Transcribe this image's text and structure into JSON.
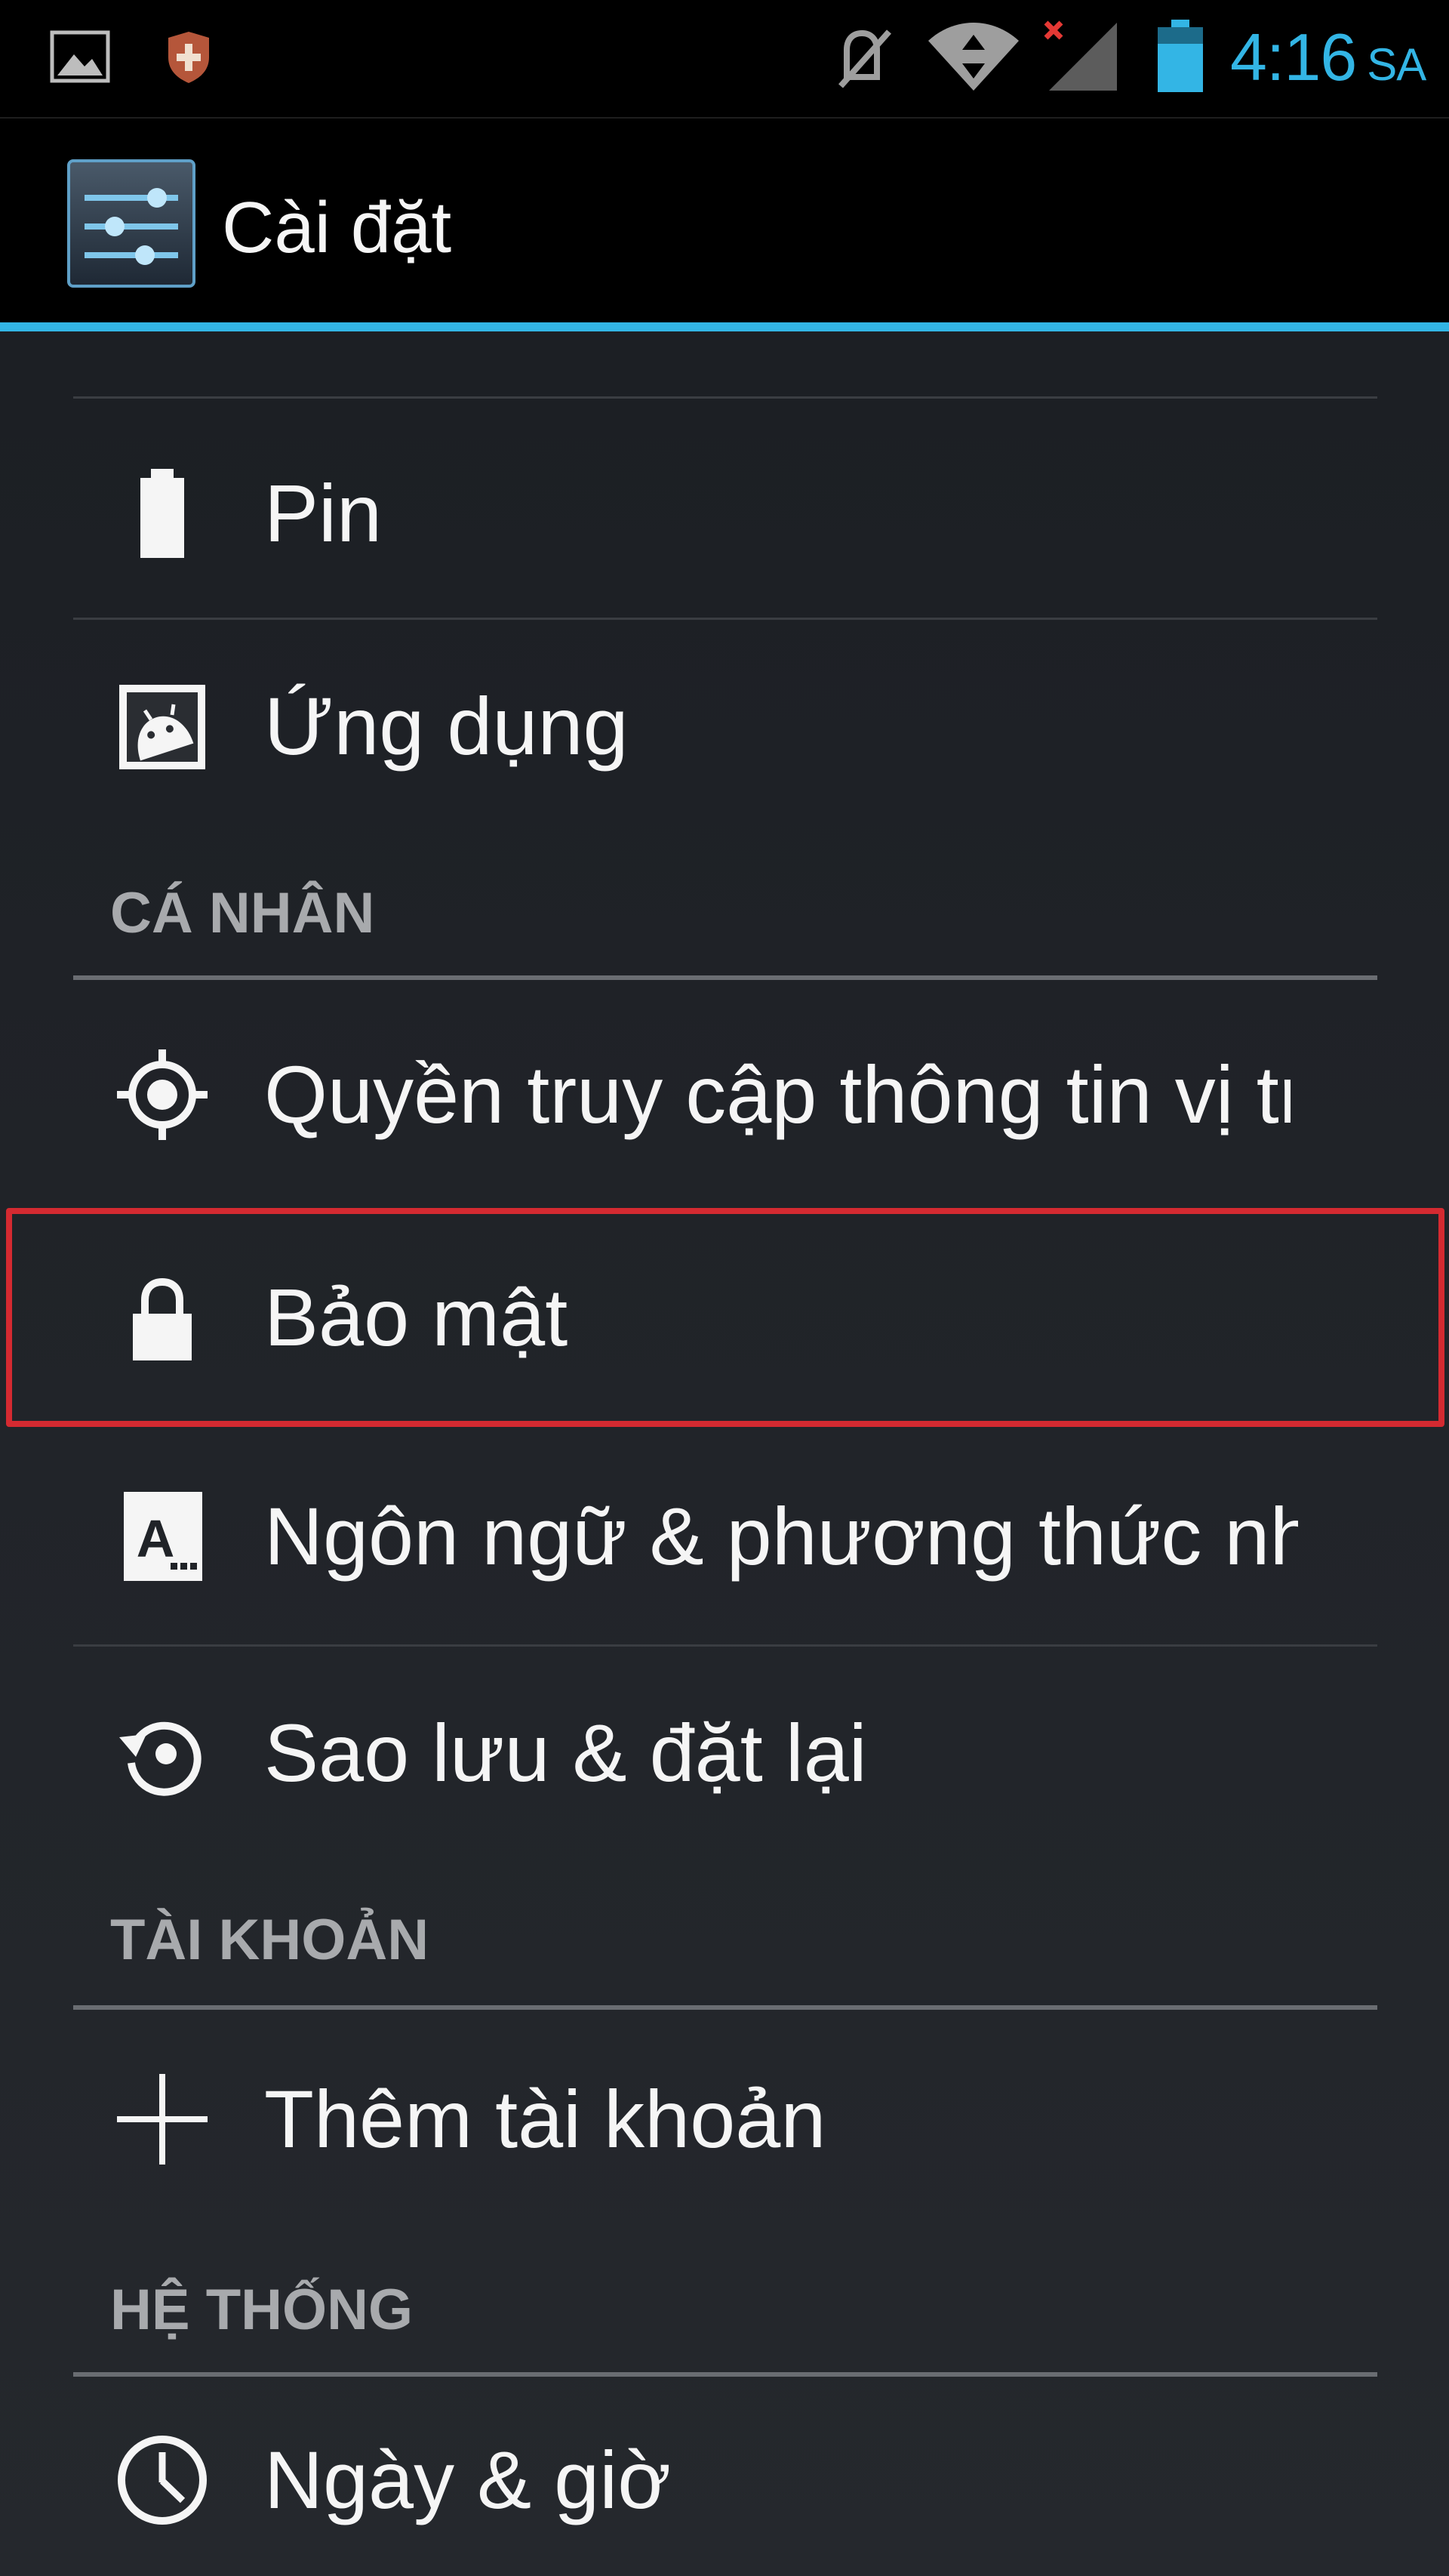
{
  "status_bar": {
    "time": "4:16",
    "ampm": "SA",
    "icons": [
      "gallery-icon",
      "shield-icon",
      "mute-icon",
      "wifi-icon",
      "signal-icon",
      "battery-icon"
    ]
  },
  "action_bar": {
    "title": "Cài đặt",
    "icon": "settings-sliders-icon"
  },
  "items": {
    "battery": {
      "label": "Pin",
      "icon": "battery-icon"
    },
    "apps": {
      "label": "Ứng dụng",
      "icon": "apps-android-icon"
    },
    "location": {
      "label": "Quyền truy cập thông tin vị trí",
      "icon": "location-crosshair-icon"
    },
    "security": {
      "label": "Bảo mật",
      "icon": "lock-icon"
    },
    "language": {
      "label": "Ngôn ngữ & phương thức nhập",
      "icon": "language-keyboard-icon"
    },
    "backup": {
      "label": "Sao lưu & đặt lại",
      "icon": "backup-restore-icon"
    },
    "add_account": {
      "label": "Thêm tài khoản",
      "icon": "plus-icon"
    },
    "date_time": {
      "label": "Ngày & giờ",
      "icon": "clock-icon"
    }
  },
  "sections": {
    "personal": "CÁ NHÂN",
    "accounts": "TÀI KHOẢN",
    "system": "HỆ THỐNG"
  },
  "colors": {
    "accent": "#33b5e5",
    "highlight": "#d42a31",
    "background": "#202328",
    "header_text": "#a8aaad"
  }
}
